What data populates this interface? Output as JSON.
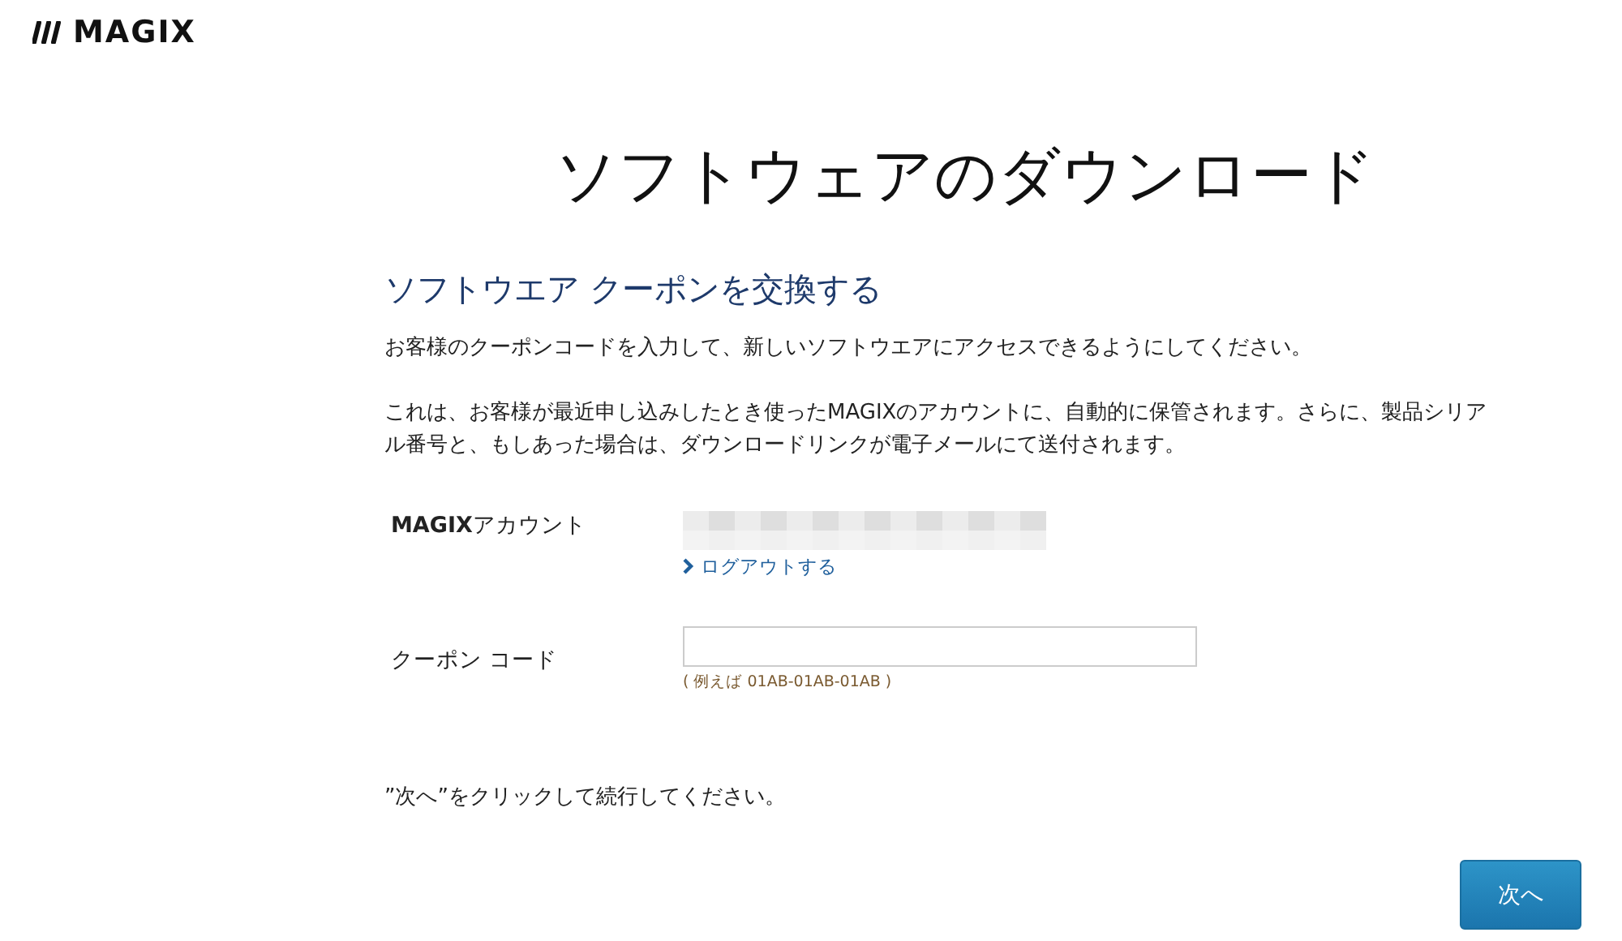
{
  "header": {
    "logo": "MAGIX"
  },
  "page_title": "ソフトウェアのダウンロード",
  "section_title": "ソフトウエア クーポンを交換する",
  "paragraphs": [
    "お客様のクーポンコードを入力して、新しいソフトウエアにアクセスできるようにしてください。",
    "これは、お客様が最近申し込みしたとき使ったMAGIXのアカウントに、自動的に保管されます。さらに、製品シリアル番号と、もしあった場合は、ダウンロードリンクが電子メールにて送付されます。"
  ],
  "account": {
    "label": "**MAGIX**アカウント",
    "logout_link": "ログアウトする"
  },
  "coupon": {
    "label": "クーポン コード",
    "hint": "( 例えば 01AB-01AB-01AB )"
  },
  "instruction": "”次へ”をクリックして続行してください。",
  "next_button": "次へ"
}
